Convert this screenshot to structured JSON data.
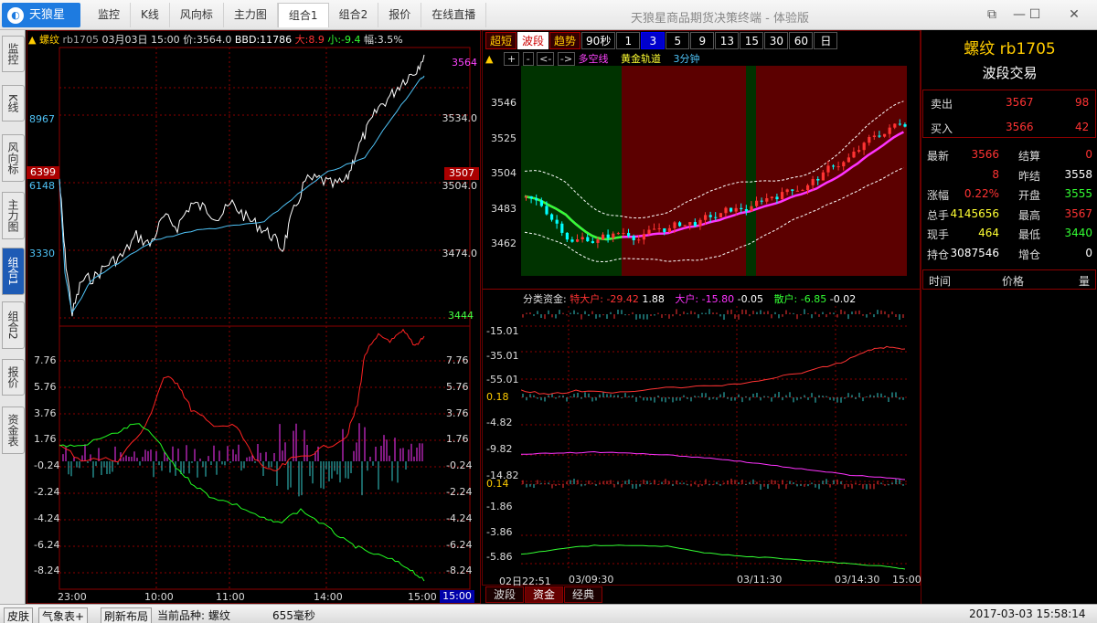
{
  "titlebar": {
    "logo": "天狼星",
    "menu": [
      "监控",
      "K线",
      "风向标",
      "主力图",
      "组合1",
      "组合2",
      "报价",
      "在线直播"
    ],
    "active_menu": 4,
    "title": "天狼星商品期货决策终端 - 体验版"
  },
  "sidebar": {
    "tabs": [
      "监控",
      "K线",
      "风向标",
      "主力图",
      "组合1",
      "组合2",
      "报价",
      "资金表"
    ],
    "active": 4
  },
  "left_chart": {
    "name": "螺纹",
    "code": "rb1705",
    "date": "03月03日",
    "time": "15:00",
    "price_label": "价:3564.0",
    "bbd_label": "BBD:11786",
    "big_label": "大:8.9",
    "small_label": "小:-9.4",
    "range_label": "幅:3.5%",
    "right_axis": [
      "3564",
      "3534.0",
      "3504.0",
      "3474.0",
      "3444"
    ],
    "left_axis": [
      "8967",
      "6399",
      "6148",
      "3330"
    ],
    "marker_left": "6399",
    "marker_right": "3507",
    "lower_axis": [
      "7.76",
      "5.76",
      "3.76",
      "1.76",
      "-0.24",
      "-2.24",
      "-4.24",
      "-6.24",
      "-8.24"
    ],
    "time_labels": [
      "23:00",
      "10:00",
      "11:00",
      "14:00",
      "15:00"
    ],
    "time_marker": "15:00"
  },
  "periods": {
    "buttons": [
      "超短",
      "波段",
      "趋势",
      "90秒",
      "1",
      "3",
      "5",
      "9",
      "13",
      "15",
      "30",
      "60",
      "日"
    ],
    "selected_mode": 1,
    "selected_num": 5
  },
  "kchart": {
    "legend": [
      "多空线",
      "黄金轨道",
      "3分钟"
    ],
    "nav": [
      "+",
      "-",
      "<-",
      "->"
    ],
    "axis": [
      "3546",
      "3525",
      "3504",
      "3483",
      "3462"
    ]
  },
  "fund_chart": {
    "header": "分类资金:",
    "items": [
      {
        "label": "特大户:",
        "v1": "-29.42",
        "v2": "1.88"
      },
      {
        "label": "大户:",
        "v1": "-15.80",
        "v2": "-0.05"
      },
      {
        "label": "散户:",
        "v1": "-6.85",
        "v2": "-0.02"
      }
    ],
    "axis1": [
      "-15.01",
      "-35.01",
      "-55.01",
      "0.18"
    ],
    "axis2": [
      "-4.82",
      "-9.82",
      "-14.82",
      "0.14"
    ],
    "axis3": [
      "-1.86",
      "-3.86",
      "-5.86"
    ],
    "time_labels": [
      "02日22:51",
      "03/09:30",
      "03/11:30",
      "03/14:30",
      "15:00"
    ]
  },
  "bottom_tabs": [
    "波段",
    "资金",
    "经典"
  ],
  "bottom_tab_active": 1,
  "info": {
    "title": "螺纹 rb1705",
    "subtitle": "波段交易",
    "sell_label": "卖出",
    "sell_price": "3567",
    "sell_vol": "98",
    "buy_label": "买入",
    "buy_price": "3566",
    "buy_vol": "42",
    "stats": [
      {
        "k1": "最新",
        "v1": "3566",
        "k2": "结算",
        "v2": "0",
        "c1": "#ff3333",
        "c2": "#ff3333"
      },
      {
        "k1": "",
        "v1": "8",
        "k2": "昨结",
        "v2": "3558",
        "c1": "#ff3333",
        "c2": "#ffffff"
      },
      {
        "k1": "涨幅",
        "v1": "0.22%",
        "k2": "开盘",
        "v2": "3555",
        "c1": "#ff3333",
        "c2": "#33ff33"
      },
      {
        "k1": "总手",
        "v1": "4145656",
        "k2": "最高",
        "v2": "3567",
        "c1": "#ffff33",
        "c2": "#ff3333"
      },
      {
        "k1": "现手",
        "v1": "464",
        "k2": "最低",
        "v2": "3440",
        "c1": "#ffff33",
        "c2": "#33ff33"
      },
      {
        "k1": "持仓",
        "v1": "3087546",
        "k2": "增仓",
        "v2": "0",
        "c1": "#ffffff",
        "c2": "#ffffff"
      }
    ],
    "trade_headers": [
      "时间",
      "价格",
      "量"
    ]
  },
  "status": {
    "skin": "皮肤",
    "weather": "气象表+",
    "refresh": "刷新布局",
    "current_label": "当前品种: 螺纹",
    "latency": "655毫秒",
    "datetime": "2017-03-03 15:58:14"
  },
  "colors": {
    "up": "#ff3333",
    "down": "#33ff33",
    "axis_red": "#8b0000",
    "price_line": "#ffffff",
    "avg_line": "#4fc3f7"
  }
}
